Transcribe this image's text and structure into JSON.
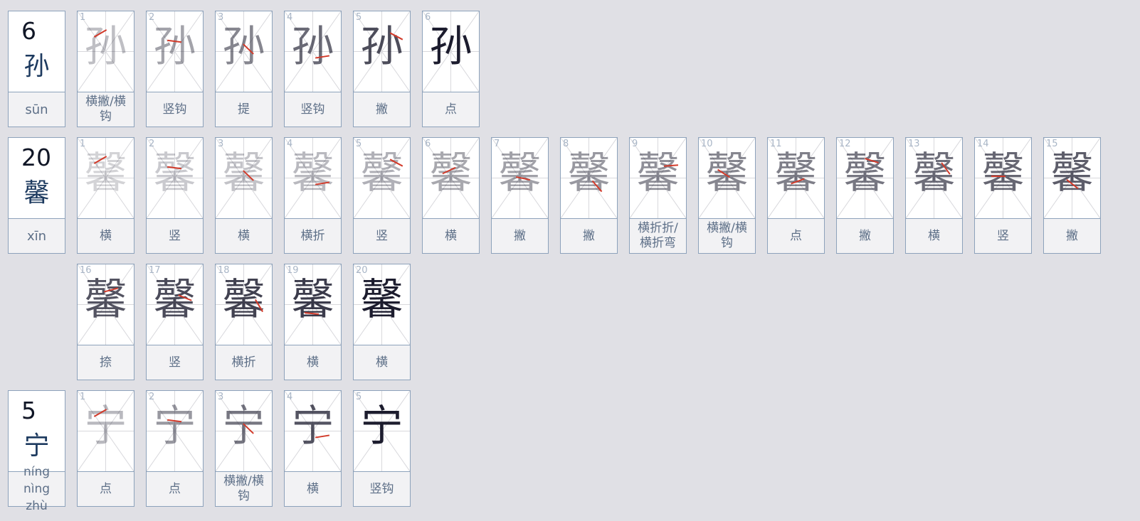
{
  "colors": {
    "background": "#e0e0e5",
    "card_border": "#8da2bb",
    "current_stroke": "#d23a2a",
    "done_stroke": "#1c1c2e",
    "label_text": "#5d6f87",
    "number_text": "#a8b5c6"
  },
  "characters": [
    {
      "char": "孙",
      "stroke_count": "6",
      "pinyin": "sūn",
      "strokes": [
        {
          "n": "1",
          "name": "横撇/横钩"
        },
        {
          "n": "2",
          "name": "竖钩"
        },
        {
          "n": "3",
          "name": "提"
        },
        {
          "n": "4",
          "name": "竖钩"
        },
        {
          "n": "5",
          "name": "撇"
        },
        {
          "n": "6",
          "name": "点"
        }
      ]
    },
    {
      "char": "馨",
      "stroke_count": "20",
      "pinyin": "xīn",
      "strokes": [
        {
          "n": "1",
          "name": "横"
        },
        {
          "n": "2",
          "name": "竖"
        },
        {
          "n": "3",
          "name": "横"
        },
        {
          "n": "4",
          "name": "横折"
        },
        {
          "n": "5",
          "name": "竖"
        },
        {
          "n": "6",
          "name": "横"
        },
        {
          "n": "7",
          "name": "撇"
        },
        {
          "n": "8",
          "name": "撇"
        },
        {
          "n": "9",
          "name": "横折折/横折弯"
        },
        {
          "n": "10",
          "name": "横撇/横钩"
        },
        {
          "n": "11",
          "name": "点"
        },
        {
          "n": "12",
          "name": "撇"
        },
        {
          "n": "13",
          "name": "横"
        },
        {
          "n": "14",
          "name": "竖"
        },
        {
          "n": "15",
          "name": "撇"
        },
        {
          "n": "16",
          "name": "捺"
        },
        {
          "n": "17",
          "name": "竖"
        },
        {
          "n": "18",
          "name": "横折"
        },
        {
          "n": "19",
          "name": "横"
        },
        {
          "n": "20",
          "name": "横"
        }
      ]
    },
    {
      "char": "宁",
      "stroke_count": "5",
      "pinyin": "níng nìng zhù",
      "strokes": [
        {
          "n": "1",
          "name": "点"
        },
        {
          "n": "2",
          "name": "点"
        },
        {
          "n": "3",
          "name": "横撇/横钩"
        },
        {
          "n": "4",
          "name": "横"
        },
        {
          "n": "5",
          "name": "竖钩"
        }
      ]
    }
  ]
}
